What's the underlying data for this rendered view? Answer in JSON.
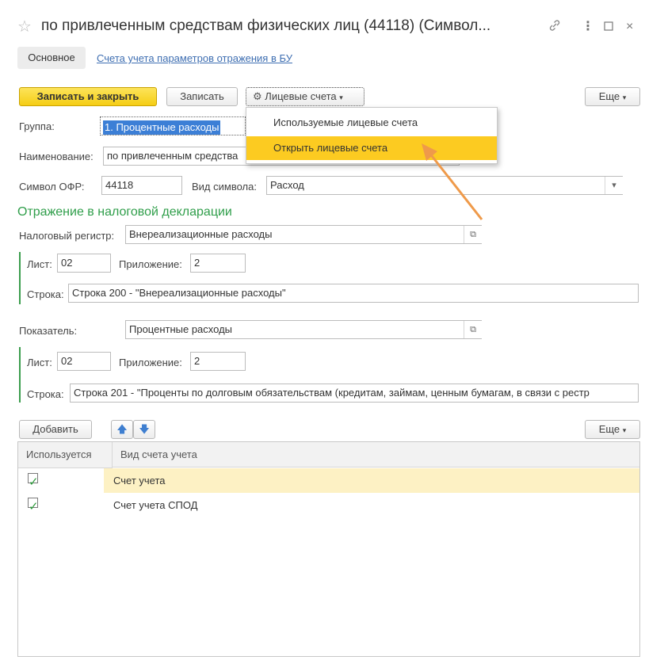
{
  "window": {
    "title": "по привлеченным средствам физических лиц (44118) (Символ...",
    "star_icon": "star-icon",
    "link_icon": "link-icon",
    "more_icon": "more-icon",
    "maximize_icon": "maximize-icon",
    "close_icon": "close-icon"
  },
  "tabs": {
    "main": "Основное",
    "accounts_link": "Счета учета параметров отражения в БУ"
  },
  "toolbar": {
    "save_close": "Записать и закрыть",
    "save": "Записать",
    "personal_accounts": "Лицевые счета",
    "more": "Еще"
  },
  "dropdown": {
    "items": [
      "Используемые лицевые счета",
      "Открыть лицевые счета"
    ]
  },
  "form": {
    "group_label": "Группа:",
    "group_value": "1. Процентные расходы",
    "name_label": "Наименование:",
    "name_value": "по привлеченным средства",
    "ofr_label": "Символ ОФР:",
    "ofr_value": "44118",
    "symbol_type_label": "Вид символа:",
    "symbol_type_value": "Расход"
  },
  "tax": {
    "section_title": "Отражение в налоговой декларации",
    "register_label": "Налоговый регистр:",
    "register_value": "Внереализационные расходы",
    "sheet1_label": "Лист:",
    "sheet1_value": "02",
    "app1_label": "Приложение:",
    "app1_value": "2",
    "line1_label": "Строка:",
    "line1_value": "Строка 200 - \"Внереализационные расходы\"",
    "indicator_label": "Показатель:",
    "indicator_value": "Процентные расходы",
    "sheet2_label": "Лист:",
    "sheet2_value": "02",
    "app2_label": "Приложение:",
    "app2_value": "2",
    "line2_label": "Строка:",
    "line2_value": "Строка 201 - \"Проценты по долговым обязательствам (кредитам, займам, ценным бумагам, в связи с рестр"
  },
  "table_toolbar": {
    "add": "Добавить",
    "up_icon": "arrow-up-icon",
    "down_icon": "arrow-down-icon",
    "more": "Еще"
  },
  "table": {
    "columns": [
      "Используется",
      "Вид счета учета"
    ],
    "rows": [
      {
        "used": true,
        "type": "Счет учета",
        "selected": true
      },
      {
        "used": true,
        "type": "Счет учета СПОД",
        "selected": false
      }
    ]
  },
  "colors": {
    "accent_yellow": "#f5cd14",
    "highlight": "#fccb21",
    "section_green": "#2f9e4a",
    "link_blue": "#3f6fb2",
    "arrow_orange": "#ef9a4a",
    "row_selected": "#fdf1c4"
  }
}
